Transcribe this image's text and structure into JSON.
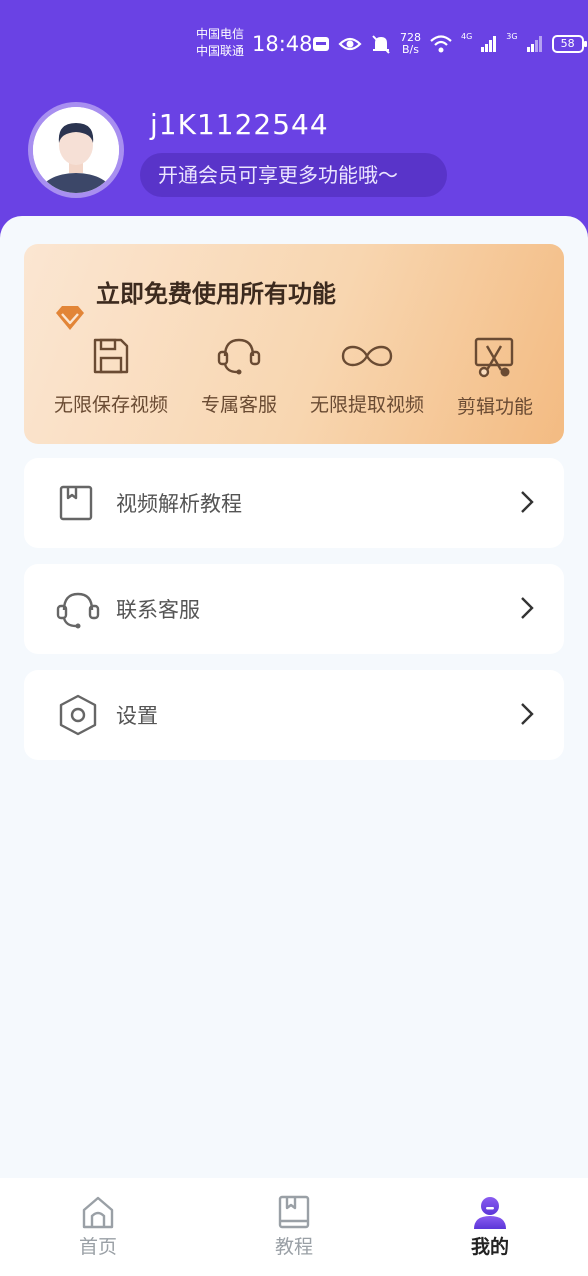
{
  "status_bar": {
    "carrier_1": "中国电信",
    "carrier_2": "中国联通",
    "time": "18:48",
    "speed_value": "728",
    "speed_unit": "B/s",
    "net_1": "4G",
    "net_2": "3G",
    "battery": "58"
  },
  "profile": {
    "username": "j1K1122544",
    "vip_prompt": "开通会员可享更多功能哦～"
  },
  "promo": {
    "title": "立即免费使用所有功能",
    "features": [
      {
        "label": "无限保存视频",
        "icon": "save-icon"
      },
      {
        "label": "专属客服",
        "icon": "headset-icon"
      },
      {
        "label": "无限提取视频",
        "icon": "infinity-icon"
      },
      {
        "label": "剪辑功能",
        "icon": "scissors-icon"
      }
    ]
  },
  "menu": [
    {
      "label": "视频解析教程",
      "icon": "bookmark-icon"
    },
    {
      "label": "联系客服",
      "icon": "headset-icon"
    },
    {
      "label": "设置",
      "icon": "settings-icon"
    }
  ],
  "nav": {
    "home": "首页",
    "tutorial": "教程",
    "mine": "我的",
    "active": "mine"
  },
  "colors": {
    "brand": "#6a42e4",
    "promo_text": "#6a4b33",
    "promo_accent": "#e07a2a"
  }
}
